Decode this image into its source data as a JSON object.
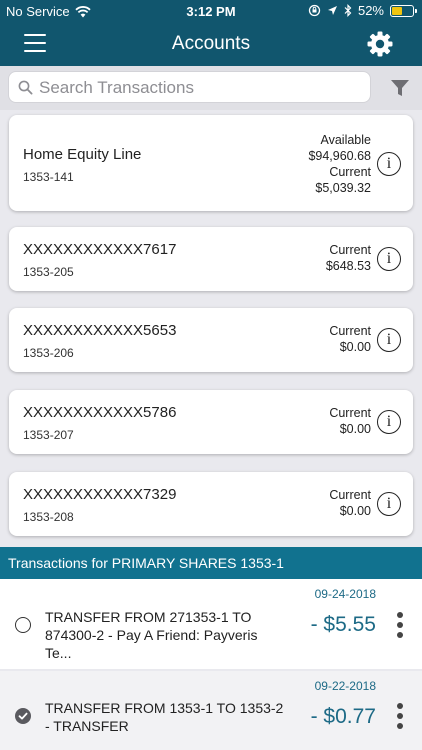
{
  "status_bar": {
    "carrier": "No Service",
    "time": "3:12 PM",
    "battery": "52%",
    "battery_level": 0.52
  },
  "header": {
    "title": "Accounts"
  },
  "search": {
    "placeholder": "Search Transactions"
  },
  "accounts": [
    {
      "name": "Home Equity Line",
      "number": "1353-141",
      "available_label": "Available",
      "available_value": "$94,960.68",
      "current_label": "Current",
      "current_value": "$5,039.32"
    },
    {
      "name": "XXXXXXXXXXXX7617",
      "number": "1353-205",
      "current_label": "Current",
      "current_value": "$648.53"
    },
    {
      "name": "XXXXXXXXXXXX5653",
      "number": "1353-206",
      "current_label": "Current",
      "current_value": "$0.00"
    },
    {
      "name": "XXXXXXXXXXXX5786",
      "number": "1353-207",
      "current_label": "Current",
      "current_value": "$0.00"
    },
    {
      "name": "XXXXXXXXXXXX7329",
      "number": "1353-208",
      "current_label": "Current",
      "current_value": "$0.00"
    }
  ],
  "transactions_header": "Transactions for PRIMARY SHARES 1353-1",
  "transactions": [
    {
      "date": "09-24-2018",
      "description": "TRANSFER FROM 271353-1 TO 874300-2 - Pay A Friend: Payveris Te...",
      "amount": "- $5.55",
      "cleared": false
    },
    {
      "date": "09-22-2018",
      "description": "TRANSFER FROM 1353-1 TO 1353-2 - TRANSFER",
      "amount": "- $0.77",
      "cleared": true
    }
  ],
  "colors": {
    "header_bg": "#11566e",
    "section_bg": "#11728f",
    "accent_text": "#1d6a86",
    "battery": "#f1c40f"
  },
  "icons": {
    "menu": "hamburger-menu-icon",
    "settings": "gear-icon",
    "search": "search-icon",
    "filter": "funnel-filter-icon",
    "info": "info-icon",
    "more": "more-vertical-icon"
  }
}
